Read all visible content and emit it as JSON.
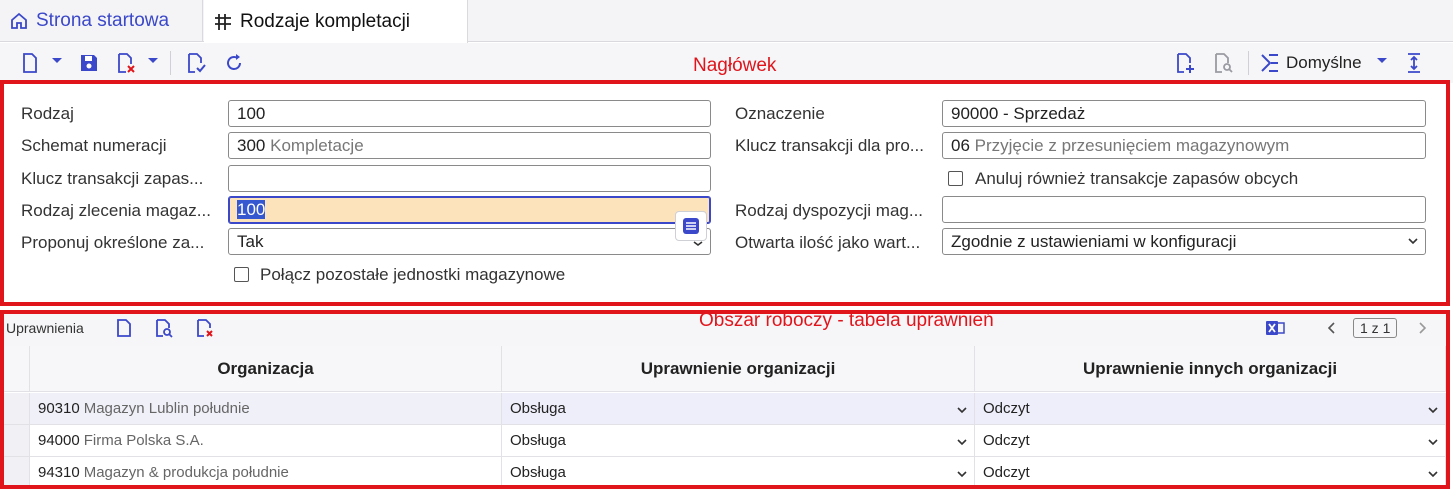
{
  "tabs": [
    {
      "label": "Strona startowa"
    },
    {
      "label": "Rodzaje kompletacji"
    }
  ],
  "toolbar": {
    "profile_label": "Domyślne"
  },
  "annotations": {
    "header": "Nagłówek",
    "work": "Obszar roboczy - tabela uprawnień"
  },
  "form": {
    "rodzaj": {
      "label": "Rodzaj",
      "value": "100"
    },
    "schemat": {
      "label": "Schemat numeracji",
      "code": "300",
      "hint": "Kompletacje"
    },
    "klucz_zapas": {
      "label": "Klucz transakcji zapas...",
      "value": ""
    },
    "rodzaj_zlecenia": {
      "label": "Rodzaj zlecenia magaz...",
      "value": "100"
    },
    "proponuj": {
      "label": "Proponuj określone za...",
      "value": "Tak"
    },
    "polacz": {
      "label": "Połącz pozostałe jednostki magazynowe",
      "checked": false
    },
    "oznaczenie": {
      "label": "Oznaczenie",
      "value": "90000 - Sprzedaż"
    },
    "klucz_pro": {
      "label": "Klucz transakcji dla pro...",
      "code": "06",
      "hint": "Przyjęcie z przesunięciem magazynowym"
    },
    "anuluj": {
      "label": "Anuluj również transakcje zapasów obcych",
      "checked": false
    },
    "rodzaj_dyspozycji": {
      "label": "Rodzaj dyspozycji mag...",
      "value": ""
    },
    "otwarta": {
      "label": "Otwarta ilość jako wart...",
      "value": "Zgodnie z ustawieniami w konfiguracji"
    }
  },
  "work": {
    "title": "Uprawnienia",
    "pager": "1 z 1",
    "columns": [
      "Organizacja",
      "Uprawnienie organizacji",
      "Uprawnienie innych organizacji"
    ],
    "rows": [
      {
        "code": "90310",
        "name": "Magazyn Lublin południe",
        "perm": "Obsługa",
        "other": "Odczyt"
      },
      {
        "code": "94000",
        "name": "Firma Polska S.A.",
        "perm": "Obsługa",
        "other": "Odczyt"
      },
      {
        "code": "94310",
        "name": "Magazyn & produkcja południe",
        "perm": "Obsługa",
        "other": "Odczyt"
      }
    ]
  },
  "colors": {
    "accent": "#3b48c9",
    "annotation": "#e0151c",
    "focus_bg": "#fde3bb"
  }
}
